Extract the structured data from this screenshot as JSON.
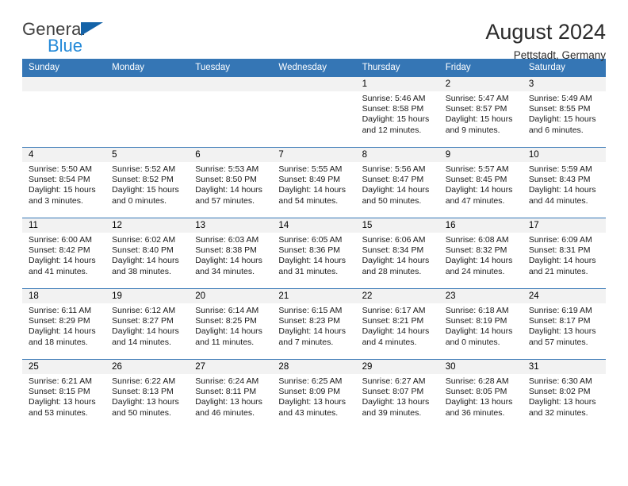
{
  "logo": {
    "text_primary": "General",
    "text_secondary": "Blue",
    "triangle_color": "#1463a8",
    "primary_color": "#3f3f3f",
    "secondary_color": "#2389d8"
  },
  "header": {
    "title": "August 2024",
    "subtitle": "Pettstadt, Germany"
  },
  "theme": {
    "header_bg": "#3576b5",
    "daynum_bg": "#f2f2f2",
    "row_border": "#3576b5"
  },
  "weekday_headers": [
    "Sunday",
    "Monday",
    "Tuesday",
    "Wednesday",
    "Thursday",
    "Friday",
    "Saturday"
  ],
  "weeks": [
    [
      {
        "day": "",
        "empty": true
      },
      {
        "day": "",
        "empty": true
      },
      {
        "day": "",
        "empty": true
      },
      {
        "day": "",
        "empty": true
      },
      {
        "day": "1",
        "sunrise": "Sunrise: 5:46 AM",
        "sunset": "Sunset: 8:58 PM",
        "daylight": "Daylight: 15 hours and 12 minutes."
      },
      {
        "day": "2",
        "sunrise": "Sunrise: 5:47 AM",
        "sunset": "Sunset: 8:57 PM",
        "daylight": "Daylight: 15 hours and 9 minutes."
      },
      {
        "day": "3",
        "sunrise": "Sunrise: 5:49 AM",
        "sunset": "Sunset: 8:55 PM",
        "daylight": "Daylight: 15 hours and 6 minutes."
      }
    ],
    [
      {
        "day": "4",
        "sunrise": "Sunrise: 5:50 AM",
        "sunset": "Sunset: 8:54 PM",
        "daylight": "Daylight: 15 hours and 3 minutes."
      },
      {
        "day": "5",
        "sunrise": "Sunrise: 5:52 AM",
        "sunset": "Sunset: 8:52 PM",
        "daylight": "Daylight: 15 hours and 0 minutes."
      },
      {
        "day": "6",
        "sunrise": "Sunrise: 5:53 AM",
        "sunset": "Sunset: 8:50 PM",
        "daylight": "Daylight: 14 hours and 57 minutes."
      },
      {
        "day": "7",
        "sunrise": "Sunrise: 5:55 AM",
        "sunset": "Sunset: 8:49 PM",
        "daylight": "Daylight: 14 hours and 54 minutes."
      },
      {
        "day": "8",
        "sunrise": "Sunrise: 5:56 AM",
        "sunset": "Sunset: 8:47 PM",
        "daylight": "Daylight: 14 hours and 50 minutes."
      },
      {
        "day": "9",
        "sunrise": "Sunrise: 5:57 AM",
        "sunset": "Sunset: 8:45 PM",
        "daylight": "Daylight: 14 hours and 47 minutes."
      },
      {
        "day": "10",
        "sunrise": "Sunrise: 5:59 AM",
        "sunset": "Sunset: 8:43 PM",
        "daylight": "Daylight: 14 hours and 44 minutes."
      }
    ],
    [
      {
        "day": "11",
        "sunrise": "Sunrise: 6:00 AM",
        "sunset": "Sunset: 8:42 PM",
        "daylight": "Daylight: 14 hours and 41 minutes."
      },
      {
        "day": "12",
        "sunrise": "Sunrise: 6:02 AM",
        "sunset": "Sunset: 8:40 PM",
        "daylight": "Daylight: 14 hours and 38 minutes."
      },
      {
        "day": "13",
        "sunrise": "Sunrise: 6:03 AM",
        "sunset": "Sunset: 8:38 PM",
        "daylight": "Daylight: 14 hours and 34 minutes."
      },
      {
        "day": "14",
        "sunrise": "Sunrise: 6:05 AM",
        "sunset": "Sunset: 8:36 PM",
        "daylight": "Daylight: 14 hours and 31 minutes."
      },
      {
        "day": "15",
        "sunrise": "Sunrise: 6:06 AM",
        "sunset": "Sunset: 8:34 PM",
        "daylight": "Daylight: 14 hours and 28 minutes."
      },
      {
        "day": "16",
        "sunrise": "Sunrise: 6:08 AM",
        "sunset": "Sunset: 8:32 PM",
        "daylight": "Daylight: 14 hours and 24 minutes."
      },
      {
        "day": "17",
        "sunrise": "Sunrise: 6:09 AM",
        "sunset": "Sunset: 8:31 PM",
        "daylight": "Daylight: 14 hours and 21 minutes."
      }
    ],
    [
      {
        "day": "18",
        "sunrise": "Sunrise: 6:11 AM",
        "sunset": "Sunset: 8:29 PM",
        "daylight": "Daylight: 14 hours and 18 minutes."
      },
      {
        "day": "19",
        "sunrise": "Sunrise: 6:12 AM",
        "sunset": "Sunset: 8:27 PM",
        "daylight": "Daylight: 14 hours and 14 minutes."
      },
      {
        "day": "20",
        "sunrise": "Sunrise: 6:14 AM",
        "sunset": "Sunset: 8:25 PM",
        "daylight": "Daylight: 14 hours and 11 minutes."
      },
      {
        "day": "21",
        "sunrise": "Sunrise: 6:15 AM",
        "sunset": "Sunset: 8:23 PM",
        "daylight": "Daylight: 14 hours and 7 minutes."
      },
      {
        "day": "22",
        "sunrise": "Sunrise: 6:17 AM",
        "sunset": "Sunset: 8:21 PM",
        "daylight": "Daylight: 14 hours and 4 minutes."
      },
      {
        "day": "23",
        "sunrise": "Sunrise: 6:18 AM",
        "sunset": "Sunset: 8:19 PM",
        "daylight": "Daylight: 14 hours and 0 minutes."
      },
      {
        "day": "24",
        "sunrise": "Sunrise: 6:19 AM",
        "sunset": "Sunset: 8:17 PM",
        "daylight": "Daylight: 13 hours and 57 minutes."
      }
    ],
    [
      {
        "day": "25",
        "sunrise": "Sunrise: 6:21 AM",
        "sunset": "Sunset: 8:15 PM",
        "daylight": "Daylight: 13 hours and 53 minutes."
      },
      {
        "day": "26",
        "sunrise": "Sunrise: 6:22 AM",
        "sunset": "Sunset: 8:13 PM",
        "daylight": "Daylight: 13 hours and 50 minutes."
      },
      {
        "day": "27",
        "sunrise": "Sunrise: 6:24 AM",
        "sunset": "Sunset: 8:11 PM",
        "daylight": "Daylight: 13 hours and 46 minutes."
      },
      {
        "day": "28",
        "sunrise": "Sunrise: 6:25 AM",
        "sunset": "Sunset: 8:09 PM",
        "daylight": "Daylight: 13 hours and 43 minutes."
      },
      {
        "day": "29",
        "sunrise": "Sunrise: 6:27 AM",
        "sunset": "Sunset: 8:07 PM",
        "daylight": "Daylight: 13 hours and 39 minutes."
      },
      {
        "day": "30",
        "sunrise": "Sunrise: 6:28 AM",
        "sunset": "Sunset: 8:05 PM",
        "daylight": "Daylight: 13 hours and 36 minutes."
      },
      {
        "day": "31",
        "sunrise": "Sunrise: 6:30 AM",
        "sunset": "Sunset: 8:02 PM",
        "daylight": "Daylight: 13 hours and 32 minutes."
      }
    ]
  ]
}
